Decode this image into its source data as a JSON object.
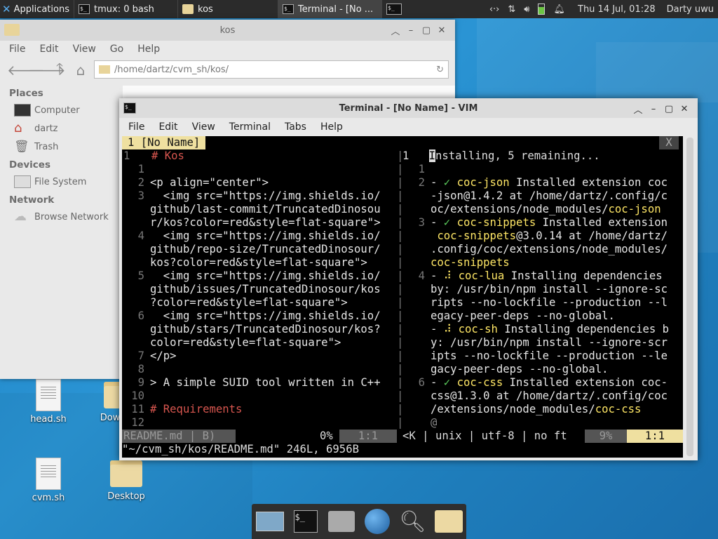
{
  "top_panel": {
    "apps_label": "Applications",
    "tasks": [
      {
        "label": "tmux: 0 bash",
        "icon": "terminal-icon"
      },
      {
        "label": "kos",
        "icon": "folder-icon"
      },
      {
        "label": "Terminal - [No ...",
        "icon": "terminal-icon"
      }
    ],
    "clock": "Thu 14 Jul, 01:28",
    "user": "Darty uwu"
  },
  "file_manager": {
    "title": "kos",
    "menu": [
      "File",
      "Edit",
      "View",
      "Go",
      "Help"
    ],
    "location": "/home/dartz/cvm_sh/kos/",
    "sidebar": {
      "places_header": "Places",
      "places": [
        "Computer",
        "dartz",
        "Trash"
      ],
      "devices_header": "Devices",
      "devices": [
        "File System"
      ],
      "network_header": "Network",
      "network": [
        "Browse Network"
      ]
    }
  },
  "desktop_icons": [
    "head.sh",
    "Dow",
    "cvm.sh",
    "Desktop"
  ],
  "terminal": {
    "title": "Terminal - [No Name] - VIM",
    "menu": [
      "File",
      "Edit",
      "View",
      "Terminal",
      "Tabs",
      "Help"
    ],
    "tab_label": " 1 [No Name]",
    "tab_close": "X",
    "left_header_num": "1",
    "left_lines": [
      {
        "n": "1",
        "text": "# Kos",
        "cls": "c-red"
      },
      {
        "n": "1",
        "text": "",
        "cls": ""
      },
      {
        "n": "2",
        "text": "<p align=\"center\">",
        "cls": "c-white"
      },
      {
        "n": "3",
        "text": "  <img src=\"https://img.shields.io/",
        "cls": "c-white"
      },
      {
        "n": "",
        "text": "github/last-commit/TruncatedDinosou",
        "cls": "c-white"
      },
      {
        "n": "",
        "text": "r/kos?color=red&style=flat-square\">",
        "cls": "c-white"
      },
      {
        "n": "4",
        "text": "  <img src=\"https://img.shields.io/",
        "cls": "c-white"
      },
      {
        "n": "",
        "text": "github/repo-size/TruncatedDinosour/",
        "cls": "c-white"
      },
      {
        "n": "",
        "text": "kos?color=red&style=flat-square\">",
        "cls": "c-white"
      },
      {
        "n": "5",
        "text": "  <img src=\"https://img.shields.io/",
        "cls": "c-white"
      },
      {
        "n": "",
        "text": "github/issues/TruncatedDinosour/kos",
        "cls": "c-white"
      },
      {
        "n": "",
        "text": "?color=red&style=flat-square\">",
        "cls": "c-white"
      },
      {
        "n": "6",
        "text": "  <img src=\"https://img.shields.io/",
        "cls": "c-white"
      },
      {
        "n": "",
        "text": "github/stars/TruncatedDinosour/kos?",
        "cls": "c-white"
      },
      {
        "n": "",
        "text": "color=red&style=flat-square\">",
        "cls": "c-white"
      },
      {
        "n": "7",
        "text": "</p>",
        "cls": "c-white"
      },
      {
        "n": "8",
        "text": "",
        "cls": ""
      },
      {
        "n": "9",
        "text": "> A simple SUID tool written in C++",
        "cls": "c-white"
      },
      {
        "n": "10",
        "text": "",
        "cls": ""
      },
      {
        "n": "11",
        "text": "# Requirements",
        "cls": "c-red"
      },
      {
        "n": "12",
        "text": "",
        "cls": ""
      }
    ],
    "right_header": "1   Installing, 5 remaining...",
    "right_lines": [
      {
        "n": "1",
        "text": ""
      },
      {
        "n": "2",
        "text": "- ✓ coc-json Installed extension coc"
      },
      {
        "n": "",
        "text": "-json@1.4.2 at /home/dartz/.config/c"
      },
      {
        "n": "",
        "text": "oc/extensions/node_modules/coc-json"
      },
      {
        "n": "3",
        "text": "- ✓ coc-snippets Installed extension"
      },
      {
        "n": "",
        "text": " coc-snippets@3.0.14 at /home/dartz/"
      },
      {
        "n": "",
        "text": ".config/coc/extensions/node_modules/"
      },
      {
        "n": "",
        "text": "coc-snippets"
      },
      {
        "n": "4",
        "text": "- ⠼ coc-lua Installing dependencies"
      },
      {
        "n": "",
        "text": "by: /usr/bin/npm install --ignore-sc"
      },
      {
        "n": "",
        "text": "ripts --no-lockfile --production --l"
      },
      {
        "n": "",
        "text": "egacy-peer-deps --no-global."
      },
      {
        "n": "",
        "text": "- ⠼ coc-sh Installing dependencies b"
      },
      {
        "n": "",
        "text": "y: /usr/bin/npm install --ignore-scr"
      },
      {
        "n": "",
        "text": "ipts --no-lockfile --production --le"
      },
      {
        "n": "",
        "text": "gacy-peer-deps --no-global."
      },
      {
        "n": "6",
        "text": "- ✓ coc-css Installed extension coc-"
      },
      {
        "n": "",
        "text": "css@1.3.0 at /home/dartz/.config/coc"
      },
      {
        "n": "",
        "text": "/extensions/node_modules/coc-css"
      },
      {
        "n": "",
        "text": "@"
      }
    ],
    "status_left_file": " README.md | B)",
    "status_left_pct": "0%",
    "status_left_pos": "1:1",
    "status_right_info": "<K | unix | utf-8 | no ft",
    "status_right_pct": "9%",
    "status_right_pos": "1:1",
    "cmdline": "\"~/cvm_sh/kos/README.md\" 246L, 6956B"
  },
  "colors": {
    "desktop": "#1f86c7",
    "term_bg": "#000000",
    "tab_active": "#efe0a0"
  }
}
